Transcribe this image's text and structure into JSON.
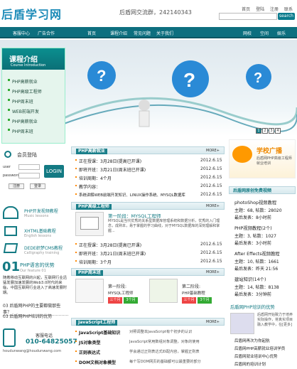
{
  "header": {
    "logo": "后盾学习网",
    "qq": "后盾网交流群，242140343",
    "links": [
      "首页",
      "登陆",
      "注册",
      "联系"
    ],
    "search_btn": "search"
  },
  "nav": {
    "left": [
      "客服中心",
      "广告合作"
    ],
    "main": [
      "首页",
      "课程介绍",
      "常见问题",
      "关于我们"
    ],
    "right": [
      "网校",
      "空间",
      "娱乐"
    ]
  },
  "course": {
    "title": "课程介绍",
    "subtitle": "Course Introduction",
    "items": [
      "PHP高薪就业",
      "PHP高级工程师",
      "PHP周末班",
      "WEB前端开发",
      "PHP高薪就业",
      "PHP周末班"
    ]
  },
  "carousel": {
    "pages": [
      "1",
      "2",
      "3",
      "4"
    ],
    "active": 0
  },
  "jiuye": {
    "title": "PHP高薪就业",
    "more": "MORE+",
    "rows": [
      {
        "text": "正在授课：3月28日(提高已开课)",
        "date": "2012.6.15"
      },
      {
        "text": "即将开班：3月21日(周末班已开课)",
        "date": "2012.6.15"
      },
      {
        "text": "培训周期：4个月",
        "date": "2012.6.15"
      },
      {
        "text": "教学内容：",
        "date": "2012.6.15"
      },
      {
        "text": "系统讲解WEB前端开发知识、LINUX操作系统、MYSQL数据库",
        "date": "2012.6.15"
      }
    ]
  },
  "engineer": {
    "title": "PHP高级工程师",
    "more": "MORE+",
    "stage": "第一阶段：MYSQL工程师",
    "desc": "MYSQL是当代优秀的关系型数据库管理系统和数据分析，优秀的入门理念，成熟本，易于掌握的学习曲线，对于MYSQL数据库的深刻理解和掌握...",
    "rows": [
      {
        "text": "正在授课：3月28日(提高已开课)",
        "date": "2012.6.15"
      },
      {
        "text": "即将开班：3月21日(周末班已开课)",
        "date": "2012.6.15"
      },
      {
        "text": "培训周期：3个月",
        "date": "2012.6.15"
      }
    ]
  },
  "weekend": {
    "title": "PHP周末班",
    "more": "MORE+",
    "c1_title": "第一阶段:",
    "c1_name": "MYSQL工程师",
    "c2_title": "第二阶段:",
    "c2_name": "PHP基础教程",
    "days": "三个月",
    "price": "3个月"
  },
  "js": {
    "title": "JavaScript工程师",
    "more": "MORE+",
    "rows": [
      {
        "a": "JavaScript基础知识",
        "b": "对照调整本JavaScript有个初步的认识"
      },
      {
        "a": "JS对象类型",
        "b": "JavaScript常用数组对象调整，对象的使用"
      },
      {
        "a": "正则表达式",
        "b": "学会通过正则表达式匹配内容，掌握正则表"
      },
      {
        "a": "DOM文档对象模型",
        "b": "每个写DOM网页的基础都可以最重要的部分"
      }
    ]
  },
  "login": {
    "title": "会员登陆",
    "user": "user",
    "password": "password",
    "btn": "LOGIN",
    "register": "注册",
    "login2": "登录"
  },
  "videos": [
    {
      "title": "PHP开发视频教程",
      "sub": "Music lessons"
    },
    {
      "title": "XHTML基础教程",
      "sub": "English lessons"
    },
    {
      "title": "DEDE织梦CMS教程",
      "sub": "Calligraphy training"
    }
  ],
  "advantage": {
    "num": "01",
    "title": "PHP语言的优势",
    "sub": "Our feature 01",
    "text": "随着移动互联网的兴起，互联网行业迅猛发展加速发展的Web3.0时代的来临，中国互联网行业进入了高速发展时期。",
    "q1": "03 后盾网PHP的主要都做那些事？",
    "q2": "03 后盾网PHP培训的优势"
  },
  "tel": {
    "label": "客服电话",
    "number": "010-64825057",
    "email": "houdunwang@houdunwang.com"
  },
  "right": {
    "ad_title": "学校广播",
    "ad_sub": "后盾网PHP高级工程师就业培训",
    "videos_title": "后盾网原创免费视频",
    "more": "MORE+",
    "videos": [
      {
        "name": "photoShop视频教程",
        "n": "(6个)",
        "main": "主题：68",
        "posts": "帖数：28020",
        "last": "最后发表：8小时前"
      },
      {
        "name": "PHP视频教程",
        "n": "(2个)",
        "main": "主题：3",
        "posts": "帖数：1027",
        "last": "最后发表：3小时前"
      },
      {
        "name": "After Effects视频教程",
        "n": "",
        "main": "主题：10",
        "posts": "帖数：1661",
        "last": "最后发表：昨天 21:56"
      },
      {
        "name": "建站知识",
        "n": "(14个)",
        "main": "主题：14",
        "posts": "帖数：8138",
        "last": "最后发表：3分钟前"
      }
    ],
    "intro_title": "后盾网PHP培训的优势",
    "intro": "后盾网开始致力于培养实际操作，将真实项目融入教学中，在[更多]",
    "links": [
      "后盾网再次为你起航",
      "后盾网PHP高薪就业培训学员",
      "后盾网就业培训中心优势",
      "后盾网的培训计划"
    ]
  }
}
